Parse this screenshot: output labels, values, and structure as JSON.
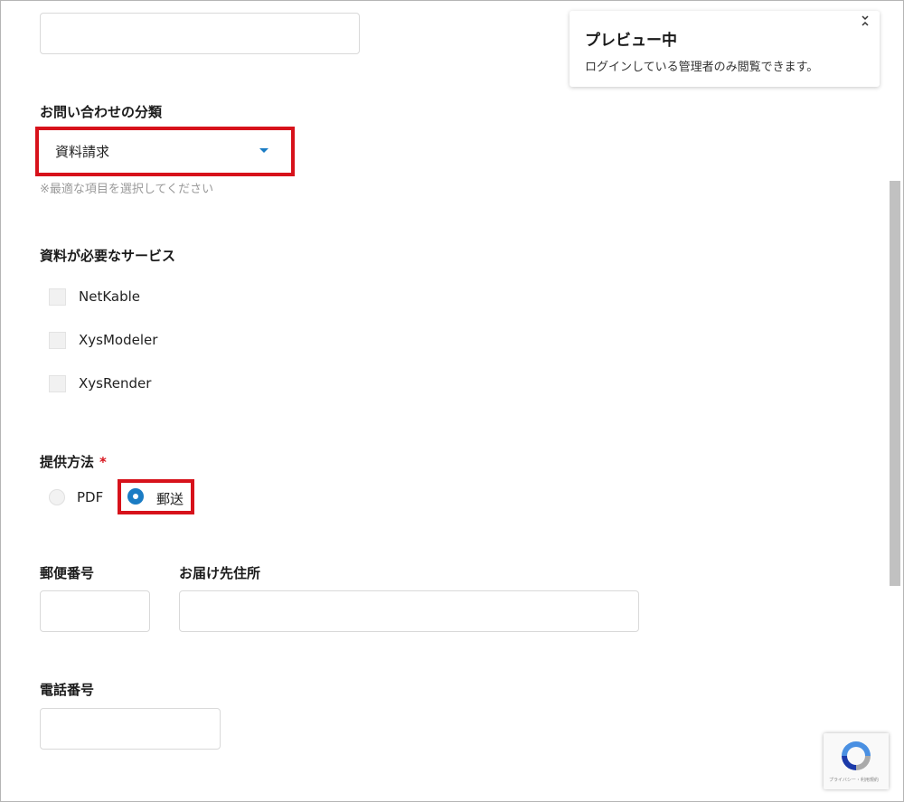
{
  "form": {
    "category": {
      "label": "お問い合わせの分類",
      "selected": "資料請求",
      "hint": "※最適な項目を選択してください"
    },
    "services": {
      "label": "資料が必要なサービス",
      "options": [
        {
          "label": "NetKable",
          "checked": false
        },
        {
          "label": "XysModeler",
          "checked": false
        },
        {
          "label": "XysRender",
          "checked": false
        }
      ]
    },
    "delivery": {
      "label": "提供方法",
      "required_mark": "*",
      "options": [
        {
          "label": "PDF",
          "selected": false
        },
        {
          "label": "郵送",
          "selected": true
        }
      ]
    },
    "postal_code": {
      "label": "郵便番号",
      "value": ""
    },
    "address": {
      "label": "お届け先住所",
      "value": ""
    },
    "phone": {
      "label": "電話番号",
      "value": ""
    }
  },
  "preview_banner": {
    "title": "プレビュー中",
    "text": "ログインしている管理者のみ閲覧できます。",
    "collapse_icon": "chevrons-collapse-icon"
  },
  "recaptcha": {
    "footer": "プライバシー・利用規約"
  },
  "colors": {
    "highlight": "#d7121b",
    "accent": "#1a7cc4",
    "required": "#d7121b"
  }
}
